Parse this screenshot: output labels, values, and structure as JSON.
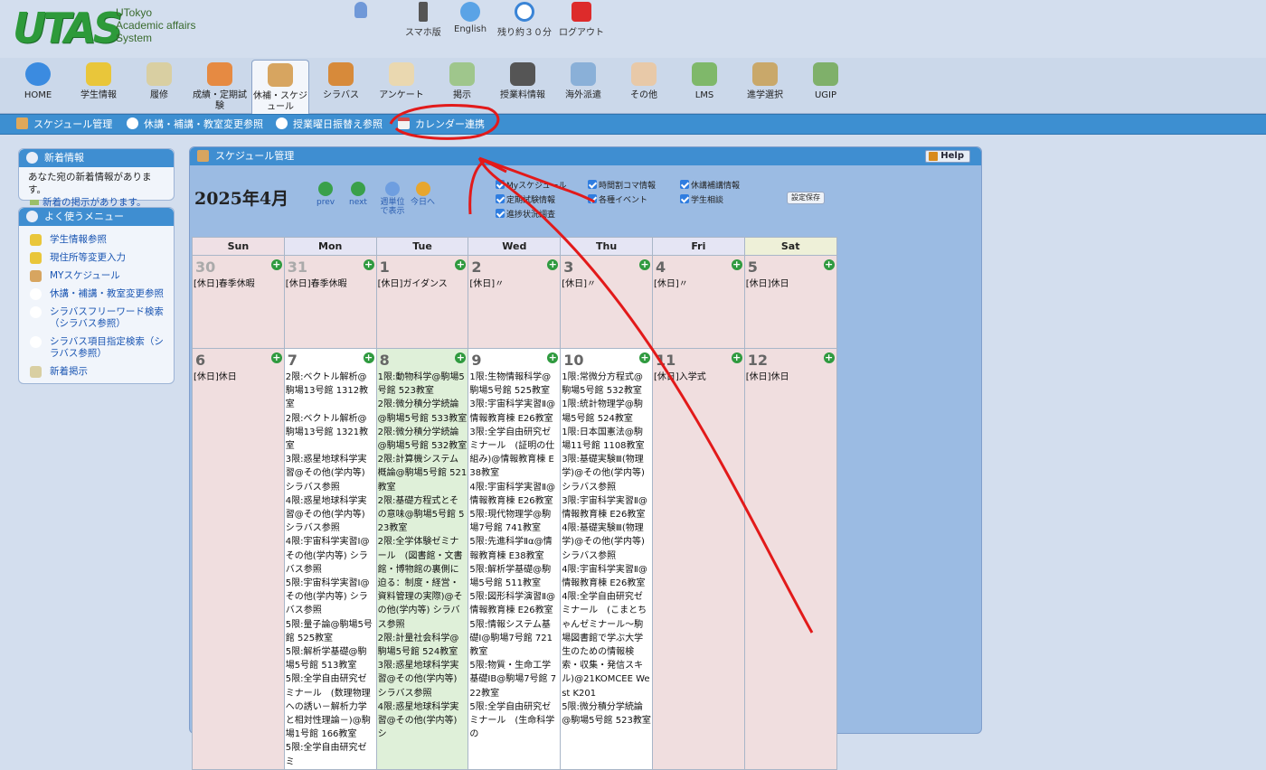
{
  "logo": {
    "mark": "UTAS",
    "subtitle": "UTokyo\nAcademic affairs\nSystem"
  },
  "toplinks": [
    {
      "icon": "person-icon",
      "label": ""
    },
    {
      "icon": "smartphone-icon",
      "label": "スマホ版"
    },
    {
      "icon": "globe-icon",
      "label": "English"
    },
    {
      "icon": "clock-icon",
      "label": "残り約３０分"
    },
    {
      "icon": "power-icon",
      "label": "ログアウト"
    }
  ],
  "nav": [
    {
      "label": "HOME",
      "icon": "home-icon"
    },
    {
      "label": "学生情報",
      "icon": "student-icon"
    },
    {
      "label": "履修",
      "icon": "pencil-icon"
    },
    {
      "label": "成績・定期試験",
      "icon": "grades-icon"
    },
    {
      "label": "休補・スケジュール",
      "icon": "book-icon",
      "active": true
    },
    {
      "label": "シラバス",
      "icon": "syllabus-icon"
    },
    {
      "label": "アンケート",
      "icon": "clipboard-icon"
    },
    {
      "label": "掲示",
      "icon": "board-icon"
    },
    {
      "label": "授業料情報",
      "icon": "printer-icon"
    },
    {
      "label": "海外派遣",
      "icon": "plane-icon"
    },
    {
      "label": "その他",
      "icon": "hand-icon"
    },
    {
      "label": "LMS",
      "icon": "building-icon"
    },
    {
      "label": "進学選択",
      "icon": "list-icon"
    },
    {
      "label": "UGIP",
      "icon": "plane2-icon"
    }
  ],
  "subnav": [
    {
      "label": "スケジュール管理",
      "icon": "book-icon"
    },
    {
      "label": "休講・補講・教室変更参照",
      "icon": "search-icon"
    },
    {
      "label": "授業曜日振替え参照",
      "icon": "search-icon"
    },
    {
      "label": "カレンダー連携",
      "icon": "calendar-icon"
    }
  ],
  "news": {
    "title": "新着情報",
    "text": "あなた宛の新着情報があります。",
    "link": "新着の掲示があります。"
  },
  "menu": {
    "title": "よく使うメニュー",
    "items": [
      "学生情報参照",
      "現住所等変更入力",
      "MYスケジュール",
      "休講・補講・教室変更参照",
      "シラバスフリーワード検索（シラバス参照）",
      "シラバス項目指定検索（シラバス参照）",
      "新着掲示"
    ]
  },
  "main": {
    "title": "スケジュール管理",
    "help": "Help",
    "month": "2025年4月",
    "controls": [
      "prev",
      "next",
      "週単位で表示",
      "今日へ"
    ],
    "checks": [
      "Myスケジュール",
      "定期試験情報",
      "進捗状況調査",
      "時間割コマ情報",
      "各種イベント",
      "休講補講情報",
      "学生相談"
    ],
    "save": "設定保存"
  },
  "calendar": {
    "days": [
      "Sun",
      "Mon",
      "Tue",
      "Wed",
      "Thu",
      "Fri",
      "Sat"
    ],
    "weeks": [
      [
        {
          "d": "30",
          "e": "[休日]春季休暇",
          "t": "prev"
        },
        {
          "d": "31",
          "e": "[休日]春季休暇",
          "t": "prev"
        },
        {
          "d": "1",
          "e": "[休日]ガイダンス",
          "t": "hol"
        },
        {
          "d": "2",
          "e": "[休日]〃",
          "t": "hol"
        },
        {
          "d": "3",
          "e": "[休日]〃",
          "t": "hol"
        },
        {
          "d": "4",
          "e": "[休日]〃",
          "t": "hol"
        },
        {
          "d": "5",
          "e": "[休日]休日",
          "t": "hol"
        }
      ],
      [
        {
          "d": "6",
          "e": "[休日]休日",
          "t": "hol"
        },
        {
          "d": "7",
          "e": "2限:ベクトル解析@駒場13号館 1312教室\n2限:ベクトル解析@駒場13号館 1321教室\n3限:惑星地球科学実習@その他(学内等) シラバス参照\n4限:惑星地球科学実習@その他(学内等) シラバス参照\n4限:宇宙科学実習Ⅰ@その他(学内等) シラバス参照\n5限:宇宙科学実習Ⅰ@その他(学内等) シラバス参照\n5限:量子論@駒場5号館 525教室\n5限:解析学基礎@駒場5号館 513教室\n5限:全学自由研究ゼミナール　(数理物理への誘い－解析力学と相対性理論－)@駒場1号館 166教室\n5限:全学自由研究ゼミ",
          "t": "cur"
        },
        {
          "d": "8",
          "e": "1限:動物科学@駒場5号館 523教室\n2限:微分積分学続論@駒場5号館 533教室\n2限:微分積分学続論@駒場5号館 532教室\n2限:計算機システム概論@駒場5号館 521教室\n2限:基礎方程式とその意味@駒場5号館 523教室\n2限:全学体験ゼミナール　(図書館・文書館・博物館の裏側に迫る：制度・経営・資料管理の実際)@その他(学内等) シラバス参照\n2限:計量社会科学@駒場5号館 524教室\n3限:惑星地球科学実習@その他(学内等) シラバス参照\n4限:惑星地球科学実習@その他(学内等) シ",
          "t": "today"
        },
        {
          "d": "9",
          "e": "1限:生物情報科学@駒場5号館 525教室\n3限:宇宙科学実習Ⅱ@情報教育棟 E26教室\n3限:全学自由研究ゼミナール　(証明の仕組み)@情報教育棟 E38教室\n4限:宇宙科学実習Ⅱ@情報教育棟 E26教室\n5限:現代物理学@駒場7号館 741教室\n5限:先進科学Ⅱα@情報教育棟 E38教室\n5限:解析学基礎@駒場5号館 511教室\n5限:図形科学演習Ⅱ@情報教育棟 E26教室\n5限:情報システム基礎Ⅰ@駒場7号館 721教室\n5限:物質・生命工学基礎ⅠB@駒場7号館 722教室\n5限:全学自由研究ゼミナール　(生命科学の",
          "t": "cur"
        },
        {
          "d": "10",
          "e": "1限:常微分方程式@駒場5号館 532教室\n1限:統計物理学@駒場5号館 524教室\n1限:日本国憲法@駒場11号館 1108教室\n3限:基礎実験Ⅲ(物理学)@その他(学内等) シラバス参照\n3限:宇宙科学実習Ⅱ@情報教育棟 E26教室\n4限:基礎実験Ⅲ(物理学)@その他(学内等) シラバス参照\n4限:宇宙科学実習Ⅱ@情報教育棟 E26教室\n4限:全学自由研究ゼミナール　(こまとちゃんゼミナール～駒場図書館で学ぶ大学生のための情報検索・収集・発信スキル)@21KOMCEE West K201\n5限:微分積分学続論@駒場5号館 523教室",
          "t": "cur"
        },
        {
          "d": "11",
          "e": "[休日]入学式",
          "t": "hol"
        },
        {
          "d": "12",
          "e": "[休日]休日",
          "t": "hol"
        }
      ]
    ]
  }
}
